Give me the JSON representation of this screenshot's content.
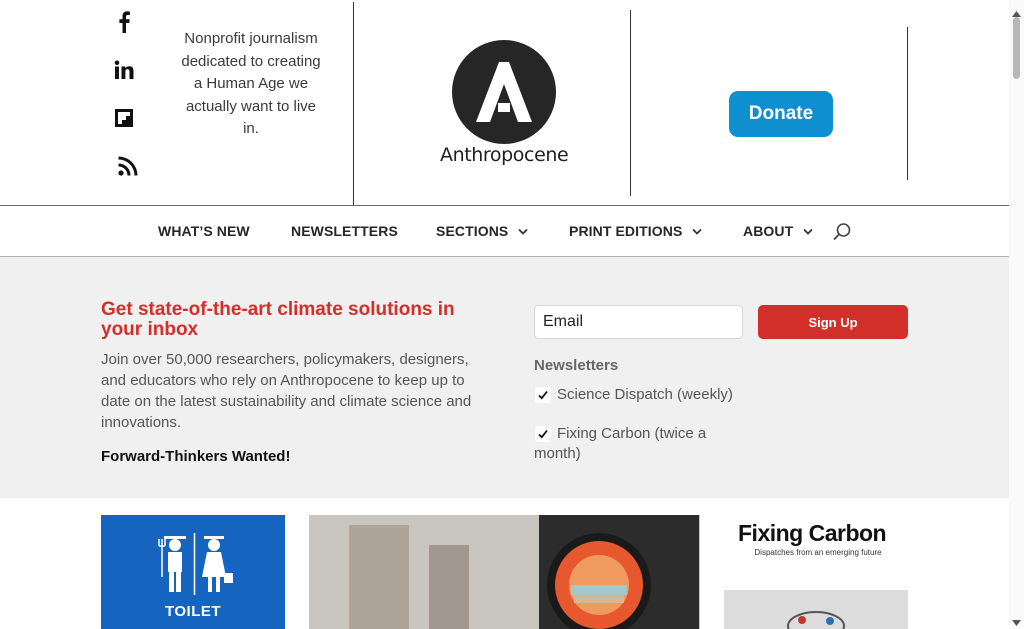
{
  "header": {
    "social": [
      {
        "icon": "facebook-icon",
        "label": "f"
      },
      {
        "icon": "linkedin-icon",
        "label": "in"
      },
      {
        "icon": "flipboard-icon",
        "label": ""
      },
      {
        "icon": "rss-icon",
        "label": ""
      }
    ],
    "tagline": "Nonprofit journalism dedicated to creating a Human Age we actually want to live in.",
    "logo_word": "Anthropocene",
    "donate_label": "Donate"
  },
  "nav": {
    "items": [
      {
        "label": "WHAT’S NEW",
        "has_dropdown": false
      },
      {
        "label": "NEWSLETTERS",
        "has_dropdown": false
      },
      {
        "label": "SECTIONS",
        "has_dropdown": true
      },
      {
        "label": "PRINT EDITIONS",
        "has_dropdown": true
      },
      {
        "label": "ABOUT",
        "has_dropdown": true
      }
    ],
    "search_icon": "search-icon"
  },
  "newsletter": {
    "heading": "Get state-of-the-art climate solutions in your inbox",
    "body": "Join over 50,000 researchers, policymakers, designers, and educators who rely on Anthropocene to keep up to date on the latest sustainability and climate science and innovations.",
    "cta": "Forward-Thinkers Wanted!",
    "email_placeholder": "Email",
    "signup_label": "Sign Up",
    "list_label": "Newsletters",
    "options": [
      {
        "label": "Science Dispatch (weekly)",
        "checked": true
      },
      {
        "label": "Fixing Carbon (twice a month)",
        "checked": true
      }
    ]
  },
  "content": {
    "toilet_label": "TOILET",
    "fixing_carbon_title": "Fixing Carbon",
    "fixing_carbon_subtitle": "Dispatches from an emerging future"
  },
  "colors": {
    "accent_red": "#d32f2a",
    "donate_blue": "#0e8fd0",
    "band_gray": "#f0f0f0"
  }
}
